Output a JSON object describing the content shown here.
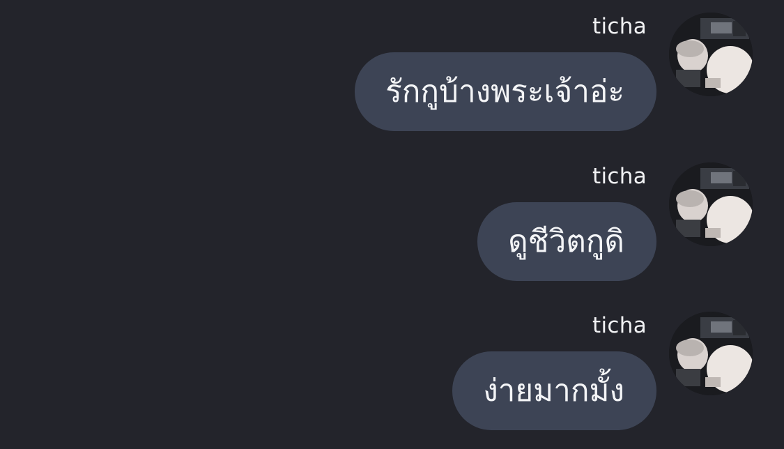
{
  "messages": [
    {
      "sender": "ticha",
      "text": "รักกูบ้างพระเจ้าอ่ะ",
      "avatar_icon": "user-photo-icon"
    },
    {
      "sender": "ticha",
      "text": "ดูชีวิตกูดิ",
      "avatar_icon": "user-photo-icon"
    },
    {
      "sender": "ticha",
      "text": "ง่ายมากมั้ง",
      "avatar_icon": "user-photo-icon"
    }
  ],
  "colors": {
    "background": "#23242b",
    "bubble": "#3d4455",
    "text": "#f4f5f7"
  }
}
